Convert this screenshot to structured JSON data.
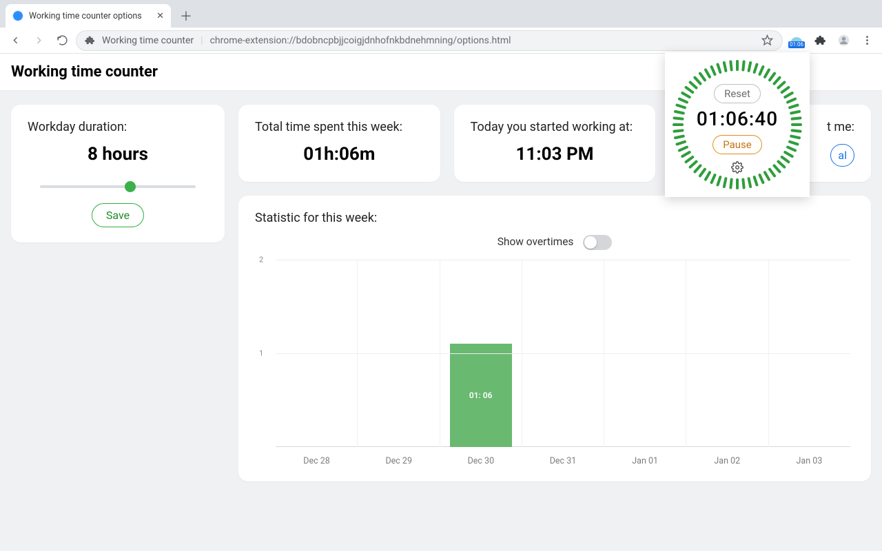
{
  "browser": {
    "tab_title": "Working time counter options",
    "address_prefix": "Working time counter",
    "url": "chrome-extension://bdobncpbjjcoigjdnhofnkbdnehmning/options.html",
    "ext_badge_time": "01:06"
  },
  "page_title": "Working time counter",
  "cards": {
    "workday": {
      "label": "Workday duration:",
      "value": "8 hours",
      "save_label": "Save",
      "slider_percent": 58
    },
    "total": {
      "label": "Total time spent this week:",
      "value": "01h:06m"
    },
    "started": {
      "label": "Today you started working at:",
      "value": "11:03 PM"
    },
    "alert": {
      "label_fragment": "t me:",
      "cal_label": "al"
    }
  },
  "stats": {
    "label": "Statistic for this week:",
    "overtime_label": "Show overtimes",
    "overtime_on": false
  },
  "popup": {
    "reset_label": "Reset",
    "pause_label": "Pause",
    "time": "01:06:40"
  },
  "chart_data": {
    "type": "bar",
    "categories": [
      "Dec 28",
      "Dec 29",
      "Dec 30",
      "Dec 31",
      "Jan 01",
      "Jan 02",
      "Jan 03"
    ],
    "values": [
      0,
      0,
      1.1,
      0,
      0,
      0,
      0
    ],
    "value_labels": [
      "",
      "",
      "01: 06",
      "",
      "",
      "",
      ""
    ],
    "y_ticks": [
      1,
      2
    ],
    "ylim": [
      0,
      2
    ],
    "title": "Statistic for this week",
    "xlabel": "",
    "ylabel": ""
  }
}
